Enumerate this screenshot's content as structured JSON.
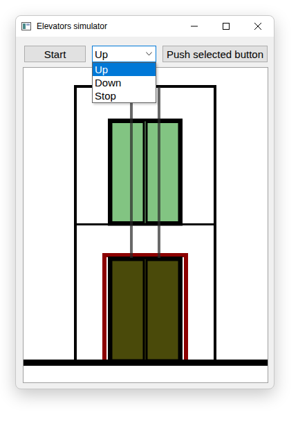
{
  "window": {
    "title": "Elevators simulator"
  },
  "toolbar": {
    "start_button": "Start",
    "button_select": {
      "value": "Up",
      "expanded": true,
      "options": [
        {
          "label": "Up",
          "selected": true
        },
        {
          "label": "Down",
          "selected": false
        },
        {
          "label": "Stop",
          "selected": false
        }
      ]
    },
    "push_button": "Push selected button"
  },
  "shaft": {
    "floors": 2,
    "elevators": [
      {
        "floor": 1,
        "color": "#82c482",
        "highlighted": false
      },
      {
        "floor": 0,
        "color": "#4a4a0a",
        "highlighted": true
      }
    ]
  }
}
